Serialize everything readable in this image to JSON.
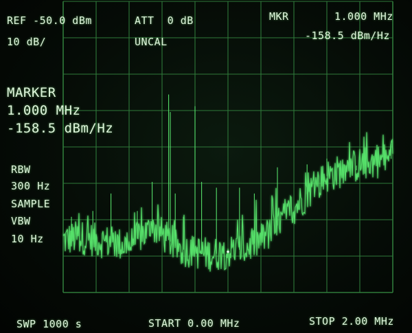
{
  "header": {
    "ref": "REF -50.0 dBm",
    "att": "ATT  0 dB",
    "mkr": "MKR",
    "mkr_freq": "1.000 MHz",
    "scale": "10 dB/",
    "uncal": "UNCAL",
    "mkr_level": "-158.5 dBm/Hz"
  },
  "marker_readout": {
    "title": "MARKER",
    "freq": "1.000 MHz",
    "level": "-158.5 dBm/Hz"
  },
  "settings": {
    "rbw_label": "RBW",
    "rbw_value": "300 Hz",
    "detector": "SAMPLE",
    "vbw_label": "VBW",
    "vbw_value": "10 Hz"
  },
  "footer": {
    "sweep": "SWP 1000 s",
    "start": "START 0.00 MHz",
    "stop": "STOP 2.00 MHz"
  },
  "colors": {
    "trace": "#56e06a",
    "grid": "#2f7a3a",
    "text": "#dff5dc"
  },
  "chart_data": {
    "type": "line",
    "xlim": [
      0,
      2.0
    ],
    "ylim": [
      -180,
      -130
    ],
    "marker": {
      "x": 1.0,
      "y": -158.5
    },
    "baseline": [
      {
        "x": 0.0,
        "y": -171
      },
      {
        "x": 0.1,
        "y": -170.5
      },
      {
        "x": 0.2,
        "y": -171
      },
      {
        "x": 0.3,
        "y": -171.5
      },
      {
        "x": 0.4,
        "y": -172
      },
      {
        "x": 0.48,
        "y": -170
      },
      {
        "x": 0.56,
        "y": -169
      },
      {
        "x": 0.62,
        "y": -170.5
      },
      {
        "x": 0.7,
        "y": -172.5
      },
      {
        "x": 0.8,
        "y": -173
      },
      {
        "x": 0.9,
        "y": -173.5
      },
      {
        "x": 1.0,
        "y": -173
      },
      {
        "x": 1.1,
        "y": -172.5
      },
      {
        "x": 1.2,
        "y": -171
      },
      {
        "x": 1.3,
        "y": -168.5
      },
      {
        "x": 1.4,
        "y": -165.5
      },
      {
        "x": 1.5,
        "y": -162.5
      },
      {
        "x": 1.6,
        "y": -160
      },
      {
        "x": 1.7,
        "y": -159
      },
      {
        "x": 1.8,
        "y": -158
      },
      {
        "x": 1.9,
        "y": -157.5
      },
      {
        "x": 2.0,
        "y": -157
      }
    ],
    "spikes": [
      {
        "x": 0.05,
        "y": -167
      },
      {
        "x": 0.18,
        "y": -166
      },
      {
        "x": 0.29,
        "y": -163
      },
      {
        "x": 0.45,
        "y": -166
      },
      {
        "x": 0.54,
        "y": -161
      },
      {
        "x": 0.64,
        "y": -146
      },
      {
        "x": 0.65,
        "y": -149
      },
      {
        "x": 0.68,
        "y": -163
      },
      {
        "x": 0.73,
        "y": -167
      },
      {
        "x": 0.8,
        "y": -148
      },
      {
        "x": 0.84,
        "y": -161
      },
      {
        "x": 0.93,
        "y": -162
      },
      {
        "x": 1.07,
        "y": -162
      },
      {
        "x": 1.16,
        "y": -163
      },
      {
        "x": 1.3,
        "y": -158.5
      },
      {
        "x": 1.48,
        "y": -158
      },
      {
        "x": 1.6,
        "y": -157
      },
      {
        "x": 1.68,
        "y": -158.5
      },
      {
        "x": 1.78,
        "y": -159
      },
      {
        "x": 1.99,
        "y": -154.5
      }
    ]
  }
}
